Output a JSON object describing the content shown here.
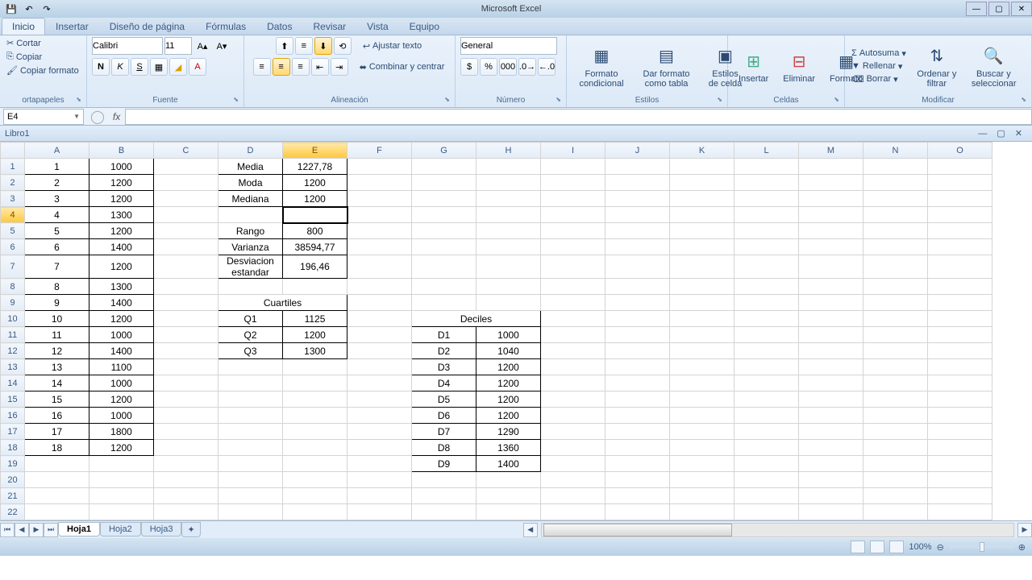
{
  "app_title": "Microsoft Excel",
  "qat": {
    "save": "💾",
    "undo": "↶",
    "redo": "↷"
  },
  "tabs": [
    "Inicio",
    "Insertar",
    "Diseño de página",
    "Fórmulas",
    "Datos",
    "Revisar",
    "Vista",
    "Equipo"
  ],
  "active_tab": 0,
  "clipboard": {
    "cut": "Cortar",
    "copy": "Copiar",
    "paste_format": "Copiar formato",
    "label": "ortapapeles"
  },
  "font": {
    "name": "Calibri",
    "size": "11",
    "label": "Fuente"
  },
  "alignment": {
    "wrap": "Ajustar texto",
    "merge": "Combinar y centrar",
    "label": "Alineación"
  },
  "number": {
    "format": "General",
    "label": "Número"
  },
  "styles": {
    "cond": "Formato condicional",
    "table": "Dar formato como tabla",
    "cell": "Estilos de celda",
    "label": "Estilos"
  },
  "cells": {
    "insert": "Insertar",
    "delete": "Eliminar",
    "format": "Formato",
    "label": "Celdas"
  },
  "editing": {
    "sum": "Autosuma",
    "fill": "Rellenar",
    "clear": "Borrar",
    "sort": "Ordenar y filtrar",
    "find": "Buscar y seleccionar",
    "label": "Modificar"
  },
  "name_box": "E4",
  "formula": "",
  "workbook": "Libro1",
  "columns": [
    "A",
    "B",
    "C",
    "D",
    "E",
    "F",
    "G",
    "H",
    "I",
    "J",
    "K",
    "L",
    "M",
    "N",
    "O"
  ],
  "selected_col": "E",
  "selected_row": 4,
  "col_b": [
    "1000",
    "1200",
    "1200",
    "1300",
    "1200",
    "1400",
    "1200",
    "1300",
    "1400",
    "1200",
    "1000",
    "1400",
    "1100",
    "1000",
    "1200",
    "1000",
    "1800",
    "1200"
  ],
  "stats": {
    "d1": "Media",
    "e1": "1227,78",
    "d2": "Moda",
    "e2": "1200",
    "d3": "Mediana",
    "e3": "1200",
    "d5": "Rango",
    "e5": "800",
    "d6": "Varianza",
    "e6": "38594,77",
    "d7": "Desviacion estandar",
    "e7": "196,46"
  },
  "quartiles": {
    "title": "Cuartiles",
    "rows": [
      {
        "q": "Q1",
        "v": "1125"
      },
      {
        "q": "Q2",
        "v": "1200"
      },
      {
        "q": "Q3",
        "v": "1300"
      }
    ]
  },
  "deciles": {
    "title": "Deciles",
    "rows": [
      {
        "d": "D1",
        "v": "1000"
      },
      {
        "d": "D2",
        "v": "1040"
      },
      {
        "d": "D3",
        "v": "1200"
      },
      {
        "d": "D4",
        "v": "1200"
      },
      {
        "d": "D5",
        "v": "1200"
      },
      {
        "d": "D6",
        "v": "1200"
      },
      {
        "d": "D7",
        "v": "1290"
      },
      {
        "d": "D8",
        "v": "1360"
      },
      {
        "d": "D9",
        "v": "1400"
      }
    ]
  },
  "sheets": [
    "Hoja1",
    "Hoja2",
    "Hoja3"
  ],
  "active_sheet": 0,
  "zoom": "100%"
}
